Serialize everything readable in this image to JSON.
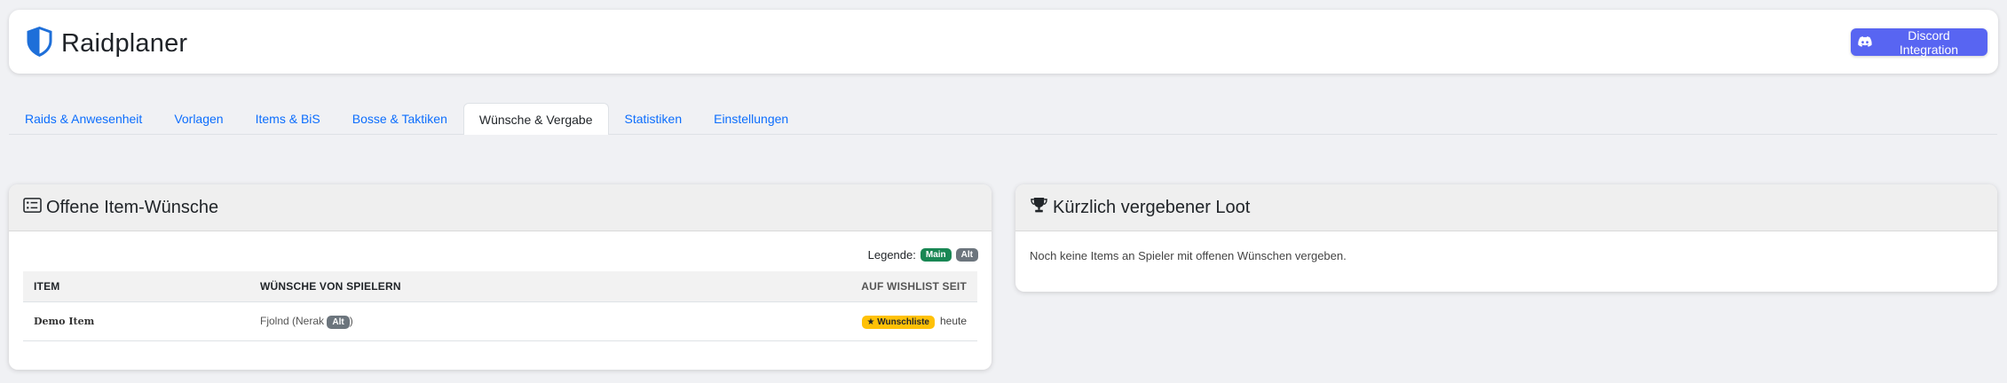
{
  "app": {
    "title": "Raidplaner",
    "discord_button": "Discord Integration",
    "accent_color": "#1e6fd9",
    "discord_color": "#5865f2"
  },
  "tabs": [
    {
      "label": "Raids & Anwesenheit",
      "active": false
    },
    {
      "label": "Vorlagen",
      "active": false
    },
    {
      "label": "Items & BiS",
      "active": false
    },
    {
      "label": "Bosse & Taktiken",
      "active": false
    },
    {
      "label": "Wünsche & Vergabe",
      "active": true
    },
    {
      "label": "Statistiken",
      "active": false
    },
    {
      "label": "Einstellungen",
      "active": false
    }
  ],
  "wishes_card": {
    "title": "Offene Item-Wünsche",
    "icon": "list-card-icon",
    "legend_label": "Legende:",
    "legend_main": "Main",
    "legend_alt": "Alt",
    "columns": [
      "Item",
      "Wünsche von Spielern",
      "Auf Wishlist seit"
    ],
    "rows": [
      {
        "item": "Demo Item",
        "player": "Fjolnd (Nerak ",
        "player_tag": "Alt",
        "player_close": ")",
        "badge": "★ Wunschliste",
        "since": "heute"
      }
    ]
  },
  "loot_card": {
    "title": "Kürzlich vergebener Loot",
    "icon": "trophy-icon",
    "empty_text": "Noch keine Items an Spieler mit offenen Wünschen vergeben."
  }
}
